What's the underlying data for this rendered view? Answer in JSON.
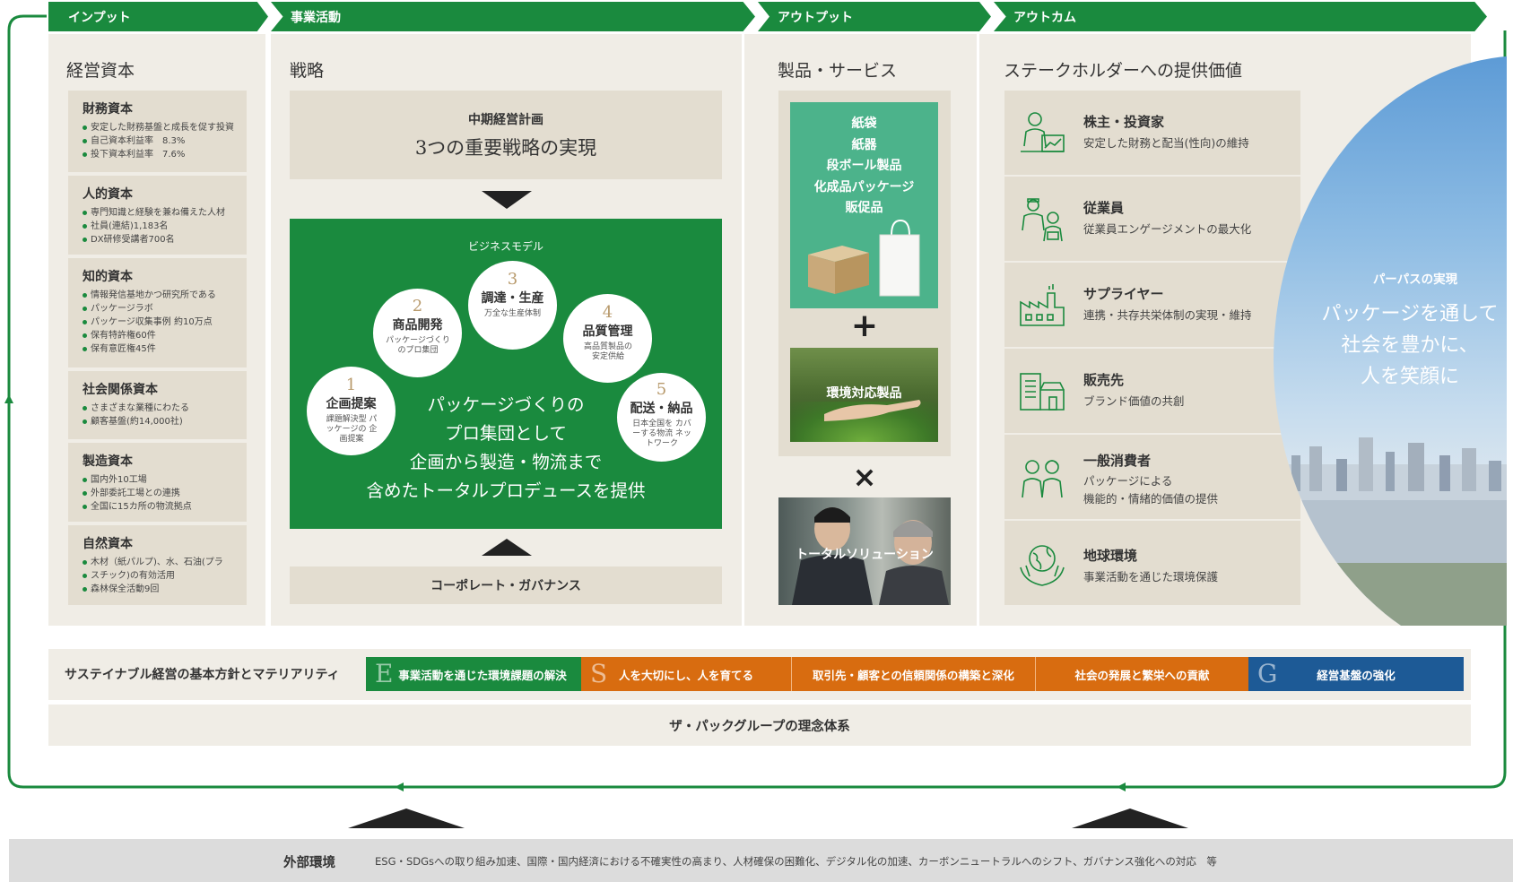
{
  "header": {
    "stage_input": "インプット",
    "stage_activity": "事業活動",
    "stage_output": "アウトプット",
    "stage_outcome": "アウトカム"
  },
  "input": {
    "title": "経営資本",
    "capitals": [
      {
        "name": "財務資本",
        "items": [
          "安定した財務基盤と成長を促す投資",
          "自己資本利益率　8.3%",
          "投下資本利益率　7.6%"
        ]
      },
      {
        "name": "人的資本",
        "items": [
          "専門知識と経験を兼ね備えた人材",
          "社員(連結)1,183名",
          "DX研修受講者700名"
        ]
      },
      {
        "name": "知的資本",
        "items": [
          "情報発信基地かつ研究所である",
          "パッケージラボ",
          "パッケージ収集事例 約10万点",
          "保有特許権60件",
          "保有意匠権45件"
        ]
      },
      {
        "name": "社会関係資本",
        "items": [
          "さまざまな業種にわたる",
          "顧客基盤(約14,000社)"
        ]
      },
      {
        "name": "製造資本",
        "items": [
          "国内外10工場",
          "外部委託工場との連携",
          "全国に15カ所の物流拠点"
        ]
      },
      {
        "name": "自然資本",
        "items": [
          "木材（紙パルプ)、水、石油(プラ",
          "スチック)の有効活用",
          "森林保全活動9回"
        ]
      }
    ]
  },
  "activity": {
    "title": "戦略",
    "plan_label": "中期経営計画",
    "plan_title": "3つの重要戦略の実現",
    "bm_label": "ビジネスモデル",
    "steps": [
      {
        "num": "1",
        "title": "企画提案",
        "sub": "課題解決型 パッケージの 企画提案"
      },
      {
        "num": "2",
        "title": "商品開発",
        "sub": "パッケージづくり のプロ集団"
      },
      {
        "num": "3",
        "title": "調達・生産",
        "sub": "万全な生産体制"
      },
      {
        "num": "4",
        "title": "品質管理",
        "sub": "高品質製品の 安定供給"
      },
      {
        "num": "5",
        "title": "配送・納品",
        "sub": "日本全国を カバーする物流 ネットワーク"
      }
    ],
    "message_lines": [
      "パッケージづくりの",
      "プロ集団として",
      "企画から製造・物流まで",
      "含めたトータルプロデュースを提供"
    ],
    "governance": "コーポレート・ガバナンス"
  },
  "output": {
    "title": "製品・サービス",
    "products": [
      "紙袋",
      "紙器",
      "段ボール製品",
      "化成品パッケージ",
      "販促品"
    ],
    "plus": "+",
    "eco_label": "環境対応製品",
    "times": "×",
    "solution_label": "トータルソリューション"
  },
  "outcome": {
    "title": "ステークホルダーへの提供価値",
    "stakeholders": [
      {
        "name": "株主・投資家",
        "desc": [
          "安定した財務と配当(性向)の維持"
        ],
        "icon": "investor-icon"
      },
      {
        "name": "従業員",
        "desc": [
          "従業員エンゲージメントの最大化"
        ],
        "icon": "employee-icon"
      },
      {
        "name": "サプライヤー",
        "desc": [
          "連携・共存共栄体制の実現・維持"
        ],
        "icon": "factory-icon"
      },
      {
        "name": "販売先",
        "desc": [
          "ブランド価値の共創"
        ],
        "icon": "store-icon"
      },
      {
        "name": "一般消費者",
        "desc": [
          "パッケージによる",
          "機能的・情緒的価値の提供"
        ],
        "icon": "consumers-icon"
      },
      {
        "name": "地球環境",
        "desc": [
          "事業活動を通じた環境保護"
        ],
        "icon": "earth-hands-icon"
      }
    ],
    "purpose_label": "パーパスの実現",
    "purpose_lines": [
      "パッケージを通して",
      "社会を豊かに、",
      "人を笑顔に"
    ]
  },
  "materiality": {
    "label": "サステイナブル経営の基本方針とマテリアリティ",
    "items": [
      {
        "letter": "E",
        "text": "事業活動を通じた環境課題の解決"
      },
      {
        "letter": "S",
        "text": "人を大切にし、人を育てる"
      },
      {
        "letter": "",
        "text": "取引先・顧客との信頼関係の構築と深化"
      },
      {
        "letter": "",
        "text": "社会の発展と繁栄への貢献"
      },
      {
        "letter": "G",
        "text": "経営基盤の強化"
      }
    ]
  },
  "philosophy": "ザ・パックグループの理念体系",
  "external": {
    "label": "外部環境",
    "text": "ESG・SDGsへの取り組み加速、国際・国内経済における不確実性の高まり、人材確保の困難化、デジタル化の加速、カーボンニュートラルへのシフト、ガバナンス強化への対応　等"
  },
  "colors": {
    "green": "#1a8a3e",
    "orange": "#d86c10",
    "blue": "#1d5a96",
    "beige": "#e3ddd0",
    "panel": "#f0ede6"
  }
}
